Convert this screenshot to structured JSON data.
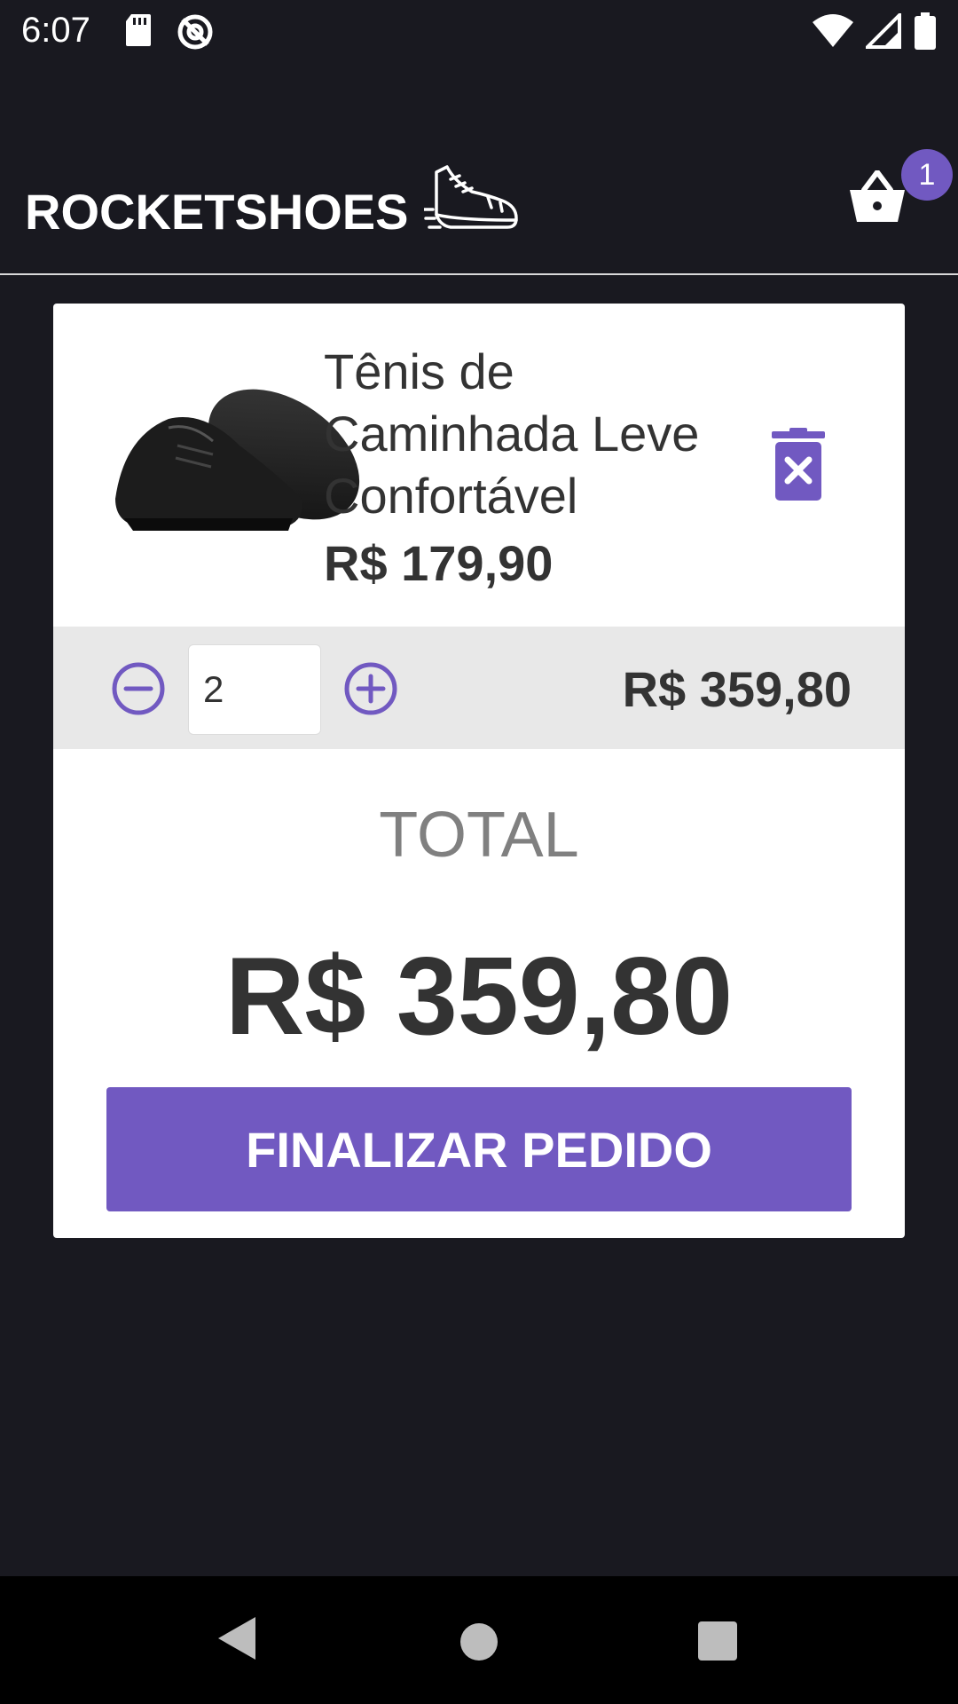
{
  "status_bar": {
    "time": "6:07",
    "icons": [
      "sd-card-icon",
      "do-not-disturb-icon",
      "wifi-icon",
      "cellular-signal-icon",
      "battery-icon"
    ]
  },
  "header": {
    "brand": "ROCKETSHOES",
    "logo_icon": "running-shoe-icon",
    "cart_icon": "basket-icon",
    "cart_count": "1"
  },
  "cart": {
    "items": [
      {
        "title": "Tênis de Caminhada Leve Confortável",
        "price": "R$ 179,90",
        "quantity": "2",
        "subtotal": "R$ 359,80"
      }
    ],
    "total_label": "TOTAL",
    "total_value": "R$ 359,80",
    "checkout_label": "FINALIZAR PEDIDO"
  },
  "colors": {
    "background": "#191920",
    "accent": "#7159c1",
    "card": "#ffffff",
    "qty_bar": "#e8e8e8",
    "text": "#333333",
    "muted": "#808080"
  },
  "nav_bar": {
    "icons": [
      "back-icon",
      "home-icon",
      "recents-icon"
    ]
  }
}
